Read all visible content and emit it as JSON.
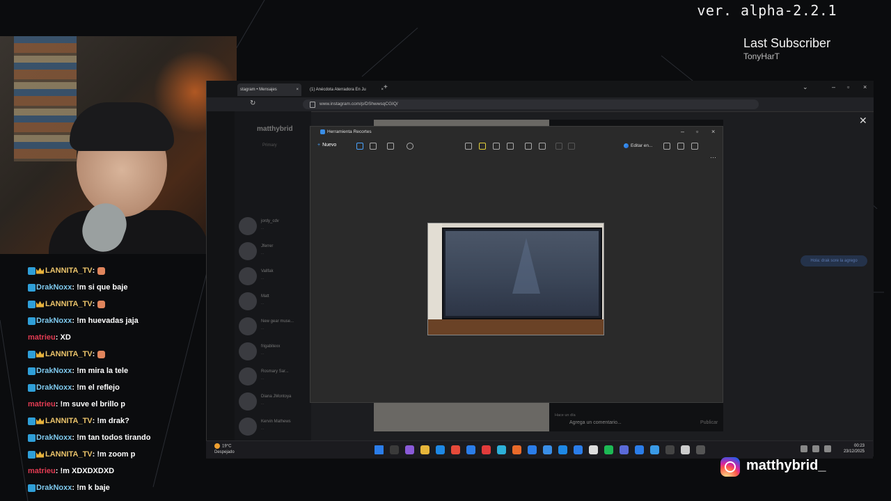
{
  "overlay": {
    "version": "ver. alpha-2.2.1",
    "last_subscriber_label": "Last Subscriber",
    "last_subscriber_name": "TonyHarT",
    "instagram_handle": "matthybrid_"
  },
  "chat": [
    {
      "user": "LANNITA_TV",
      "sep": ":",
      "text": "",
      "badge": true,
      "crown": true,
      "color": "gold",
      "emote": true
    },
    {
      "user": "DrakNoxx",
      "sep": ":",
      "text": " !m si que baje",
      "badge": true,
      "crown": false,
      "color": "blue",
      "emote": false
    },
    {
      "user": "LANNITA_TV",
      "sep": ":",
      "text": "",
      "badge": true,
      "crown": true,
      "color": "gold",
      "emote": true
    },
    {
      "user": "DrakNoxx",
      "sep": ":",
      "text": " !m huevadas jaja",
      "badge": true,
      "crown": false,
      "color": "blue",
      "emote": false
    },
    {
      "user": "matrieu",
      "sep": ":",
      "text": " XD",
      "badge": false,
      "crown": false,
      "color": "red",
      "emote": false
    },
    {
      "user": "LANNITA_TV",
      "sep": ":",
      "text": "",
      "badge": true,
      "crown": true,
      "color": "gold",
      "emote": true
    },
    {
      "user": "DrakNoxx",
      "sep": ":",
      "text": " !m mira la tele",
      "badge": true,
      "crown": false,
      "color": "blue",
      "emote": false
    },
    {
      "user": "DrakNoxx",
      "sep": ":",
      "text": " !m el reflejo",
      "badge": true,
      "crown": false,
      "color": "blue",
      "emote": false
    },
    {
      "user": "matrieu",
      "sep": ":",
      "text": " !m suve el brillo p",
      "badge": false,
      "crown": false,
      "color": "red",
      "emote": false
    },
    {
      "user": "LANNITA_TV",
      "sep": ":",
      "text": " !m drak?",
      "badge": true,
      "crown": true,
      "color": "gold",
      "emote": false
    },
    {
      "user": "DrakNoxx",
      "sep": ":",
      "text": " !m tan todos tirando",
      "badge": true,
      "crown": false,
      "color": "blue",
      "emote": false
    },
    {
      "user": "LANNITA_TV",
      "sep": ":",
      "text": " !m zoom p",
      "badge": true,
      "crown": true,
      "color": "gold",
      "emote": false
    },
    {
      "user": "matrieu",
      "sep": ":",
      "text": " !m XDXDXDXD",
      "badge": false,
      "crown": false,
      "color": "red",
      "emote": false
    },
    {
      "user": "DrakNoxx",
      "sep": ":",
      "text": " !m k baje",
      "badge": true,
      "crown": false,
      "color": "blue",
      "emote": false
    }
  ],
  "browser": {
    "tab1": "stagram • Mensajes",
    "tab2": "(1) Anécdota Aterradora En Ju",
    "url": "www.instagram.com/p/DShwwsqCGIQ/"
  },
  "instagram": {
    "username": "matthybrid",
    "primary_tab": "Primary",
    "conversations": [
      {
        "name": "jordy_cdv",
        "sub": "..."
      },
      {
        "name": "Jferrer",
        "sub": "..."
      },
      {
        "name": "Vallfak",
        "sub": "..."
      },
      {
        "name": "Matt",
        "sub": "..."
      },
      {
        "name": "New gear muse...",
        "sub": "..."
      },
      {
        "name": "frigabitexx",
        "sub": "..."
      },
      {
        "name": "Rosmary Sar...",
        "sub": "..."
      },
      {
        "name": "Diana JMontoya",
        "sub": "..."
      },
      {
        "name": "Kervin Mathews",
        "sub": "..."
      }
    ],
    "comment_placeholder": "Agrega un comentario...",
    "publish_label": "Publicar",
    "post_time": "Hace un día",
    "side_pill": "Hola: drak sore la agrego"
  },
  "snip": {
    "title": "Herramienta Recortes",
    "new_label": "Nuevo",
    "edit_label": "Editar en..."
  },
  "taskbar": {
    "temp": "19°C",
    "weather": "Despejado",
    "time": "00:23",
    "date": "23/12/2025"
  }
}
